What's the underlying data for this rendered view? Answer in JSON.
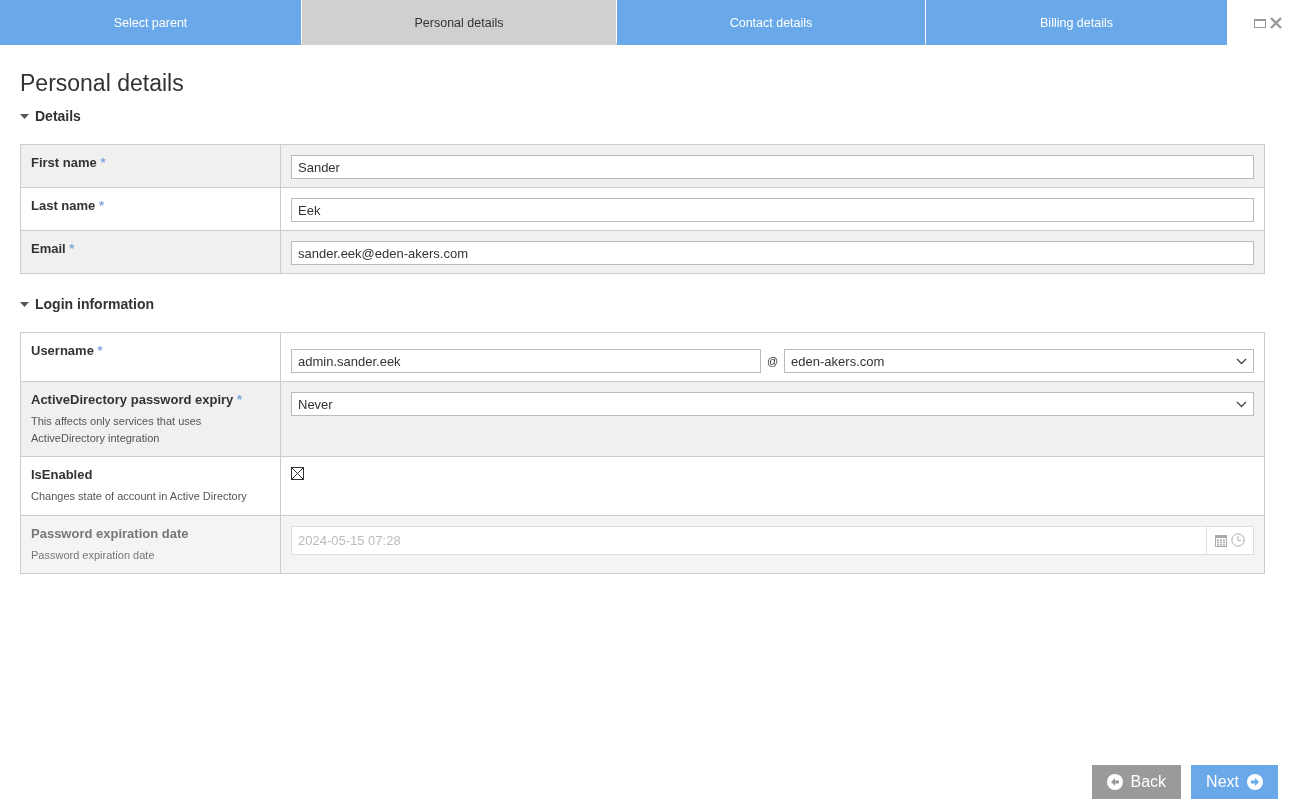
{
  "tabs": [
    {
      "label": "Select parent",
      "selected": false
    },
    {
      "label": "Personal details",
      "selected": true
    },
    {
      "label": "Contact details",
      "selected": false
    },
    {
      "label": "Billing details",
      "selected": false
    }
  ],
  "title": "Personal details",
  "sections": [
    {
      "title": "Details",
      "expanded": true,
      "rows": [
        {
          "kind": "text",
          "label": "First name",
          "required_mark": "*",
          "value": "Sander"
        },
        {
          "kind": "text",
          "label": "Last name",
          "required_mark": "*",
          "value": "Eek"
        },
        {
          "kind": "text",
          "label": "Email",
          "required_mark": "*",
          "value": "sander.eek@eden-akers.com"
        }
      ]
    },
    {
      "title": "Login information",
      "expanded": true,
      "rows": [
        {
          "kind": "username",
          "label": "Username",
          "required_mark": "*",
          "value": "admin.sander.eek",
          "separator": "@",
          "domain": "eden-akers.com"
        },
        {
          "kind": "select",
          "label": "ActiveDirectory password expiry",
          "required_mark": "*",
          "hint": "This affects only services that uses ActiveDirectory integration",
          "value": "Never"
        },
        {
          "kind": "checkbox",
          "label": "IsEnabled",
          "hint": "Changes state of account in Active Directory",
          "checked": true
        },
        {
          "kind": "datetime",
          "label": "Password expiration date",
          "disabled": true,
          "hint": "Password expiration date",
          "value": "2024-05-15 07:28"
        }
      ]
    }
  ],
  "buttons": [
    {
      "kind": "back",
      "label": "Back"
    },
    {
      "kind": "next",
      "label": "Next"
    }
  ]
}
